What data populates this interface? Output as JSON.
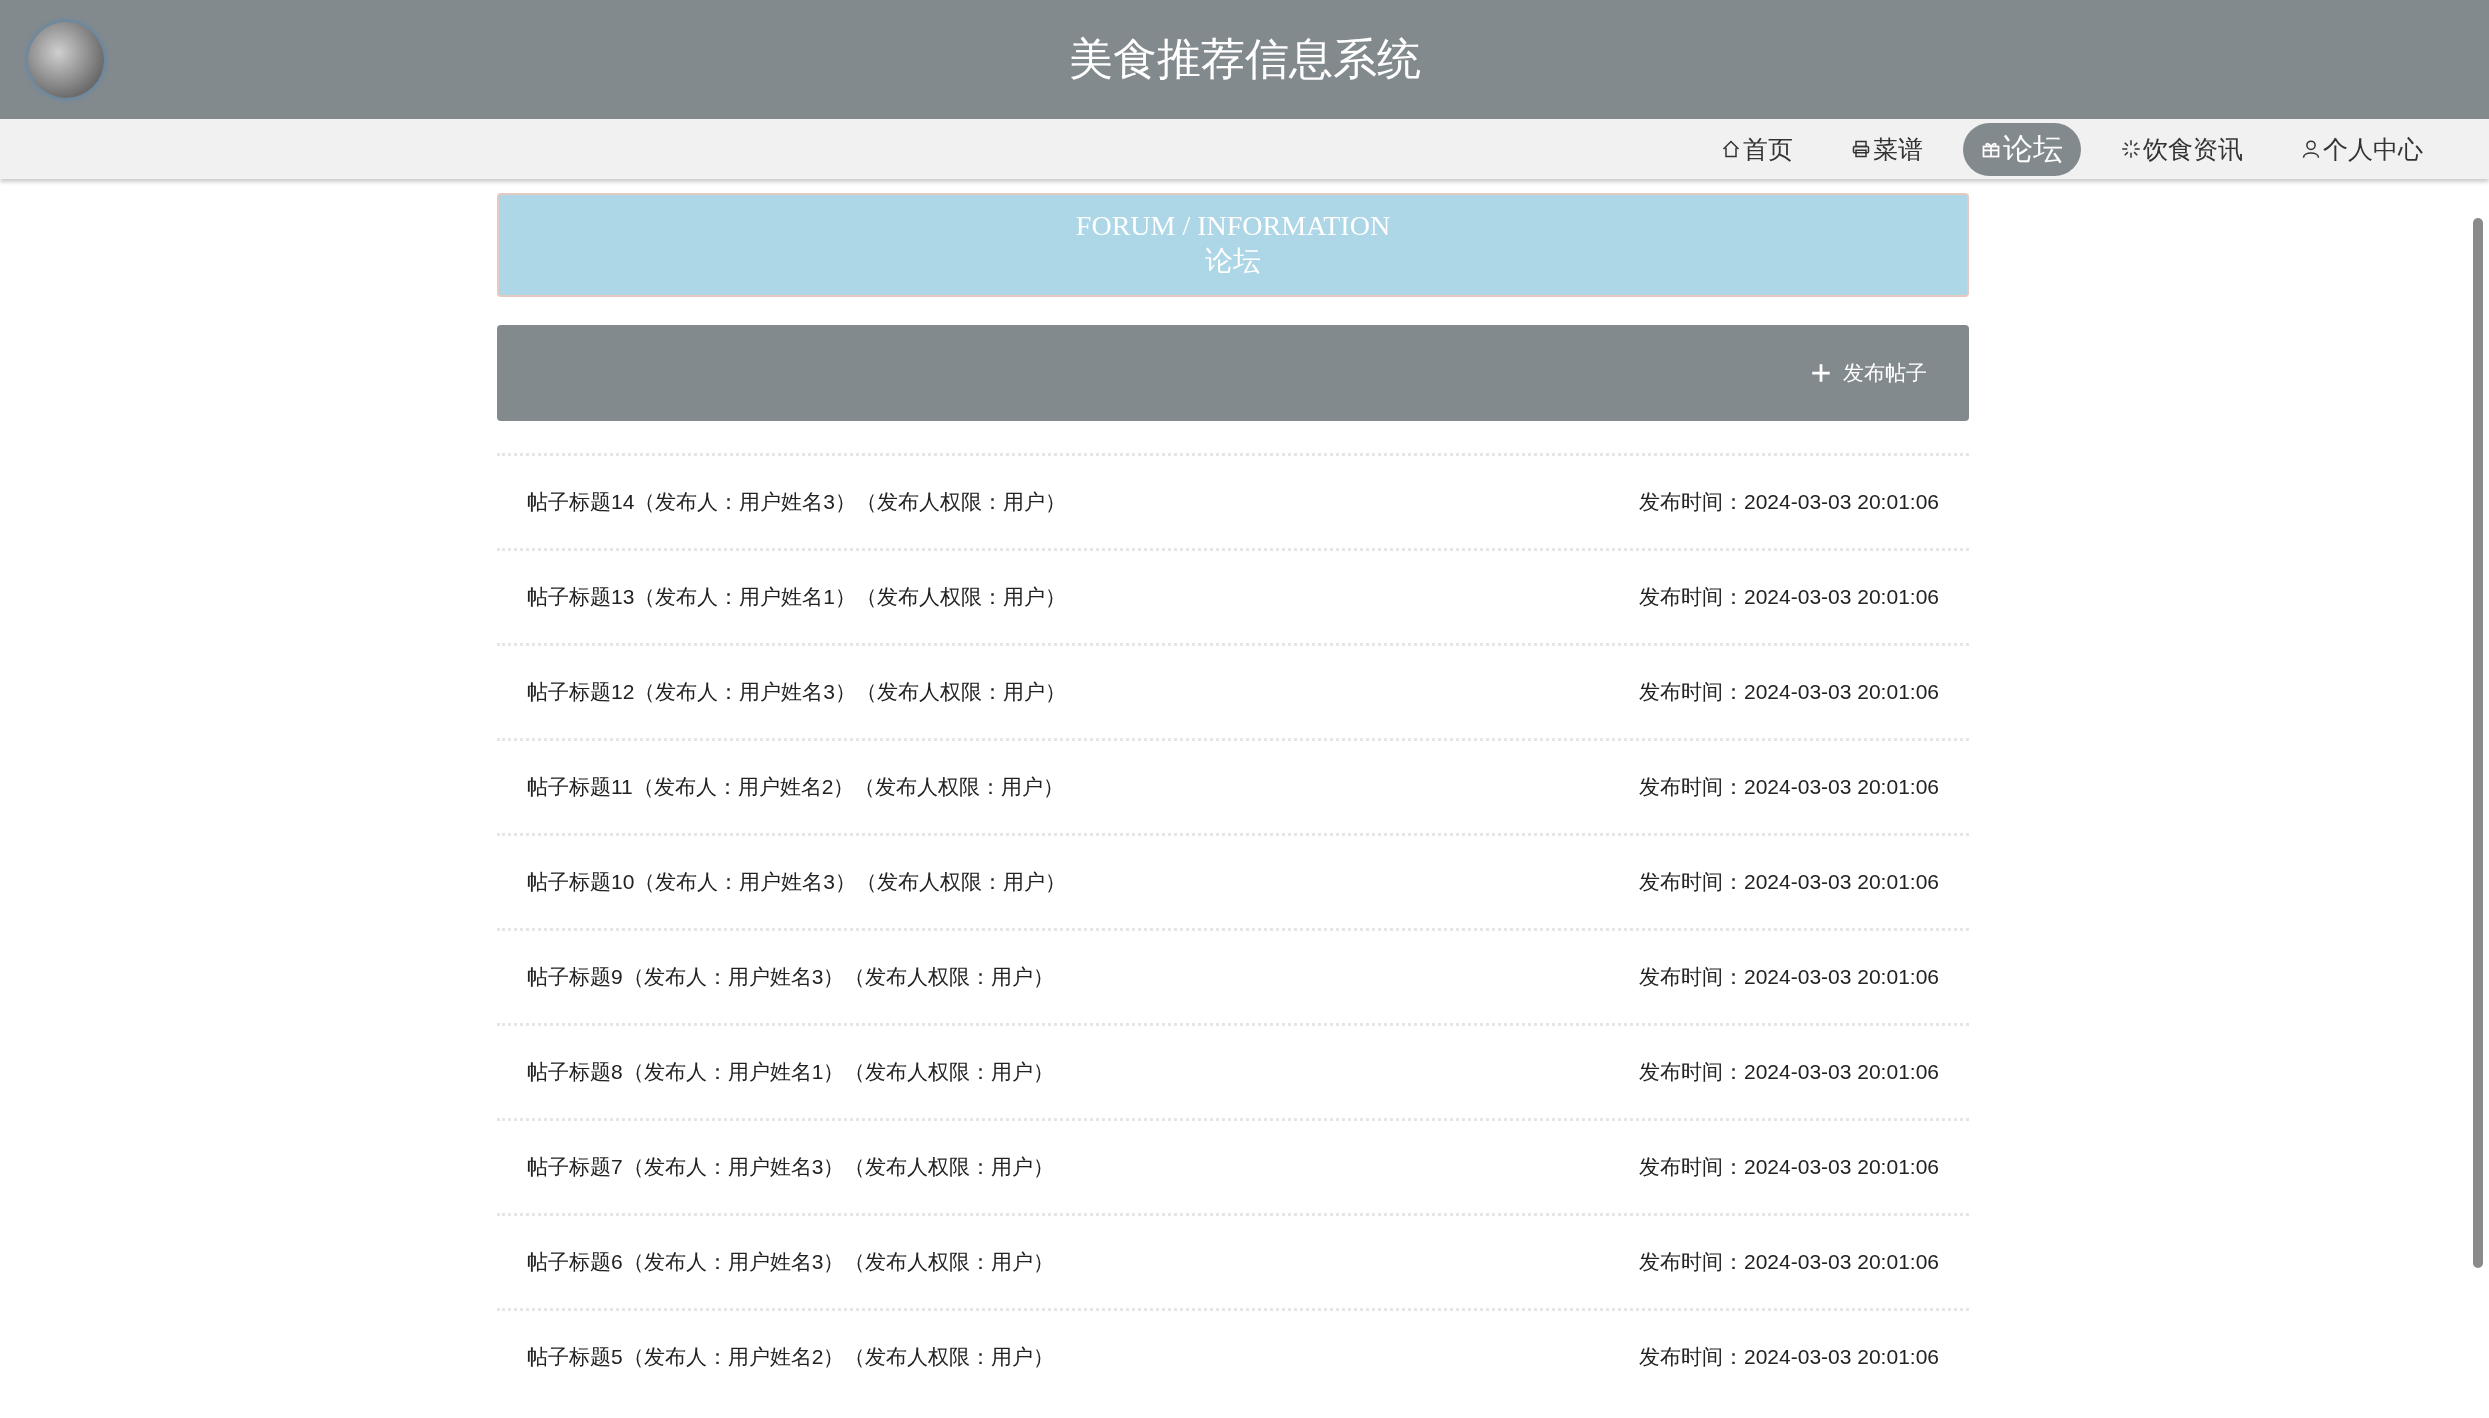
{
  "header": {
    "title": "美食推荐信息系统"
  },
  "nav": [
    {
      "label": "首页",
      "selected": false
    },
    {
      "label": "菜谱",
      "selected": false
    },
    {
      "label": "论坛",
      "selected": true
    },
    {
      "label": "饮食资讯",
      "selected": false
    },
    {
      "label": "个人中心",
      "selected": false
    }
  ],
  "banner": {
    "title_en": "FORUM / INFORMATION",
    "title_zh": "论坛"
  },
  "toolbar": {
    "button": "发布帖子"
  },
  "posts": [
    {
      "title": "帖子标题14（发布人：用户姓名3）（发布人权限：用户）",
      "time": "发布时间：2024-03-03 20:01:06"
    },
    {
      "title": "帖子标题13（发布人：用户姓名1）（发布人权限：用户）",
      "time": "发布时间：2024-03-03 20:01:06"
    },
    {
      "title": "帖子标题12（发布人：用户姓名3）（发布人权限：用户）",
      "time": "发布时间：2024-03-03 20:01:06"
    },
    {
      "title": "帖子标题11（发布人：用户姓名2）（发布人权限：用户）",
      "time": "发布时间：2024-03-03 20:01:06"
    },
    {
      "title": "帖子标题10（发布人：用户姓名3）（发布人权限：用户）",
      "time": "发布时间：2024-03-03 20:01:06"
    },
    {
      "title": "帖子标题9（发布人：用户姓名3）（发布人权限：用户）",
      "time": "发布时间：2024-03-03 20:01:06"
    },
    {
      "title": "帖子标题8（发布人：用户姓名1）（发布人权限：用户）",
      "time": "发布时间：2024-03-03 20:01:06"
    },
    {
      "title": "帖子标题7（发布人：用户姓名3）（发布人权限：用户）",
      "time": "发布时间：2024-03-03 20:01:06"
    },
    {
      "title": "帖子标题6（发布人：用户姓名3）（发布人权限：用户）",
      "time": "发布时间：2024-03-03 20:01:06"
    },
    {
      "title": "帖子标题5（发布人：用户姓名2）（发布人权限：用户）",
      "time": "发布时间：2024-03-03 20:01:06"
    }
  ]
}
